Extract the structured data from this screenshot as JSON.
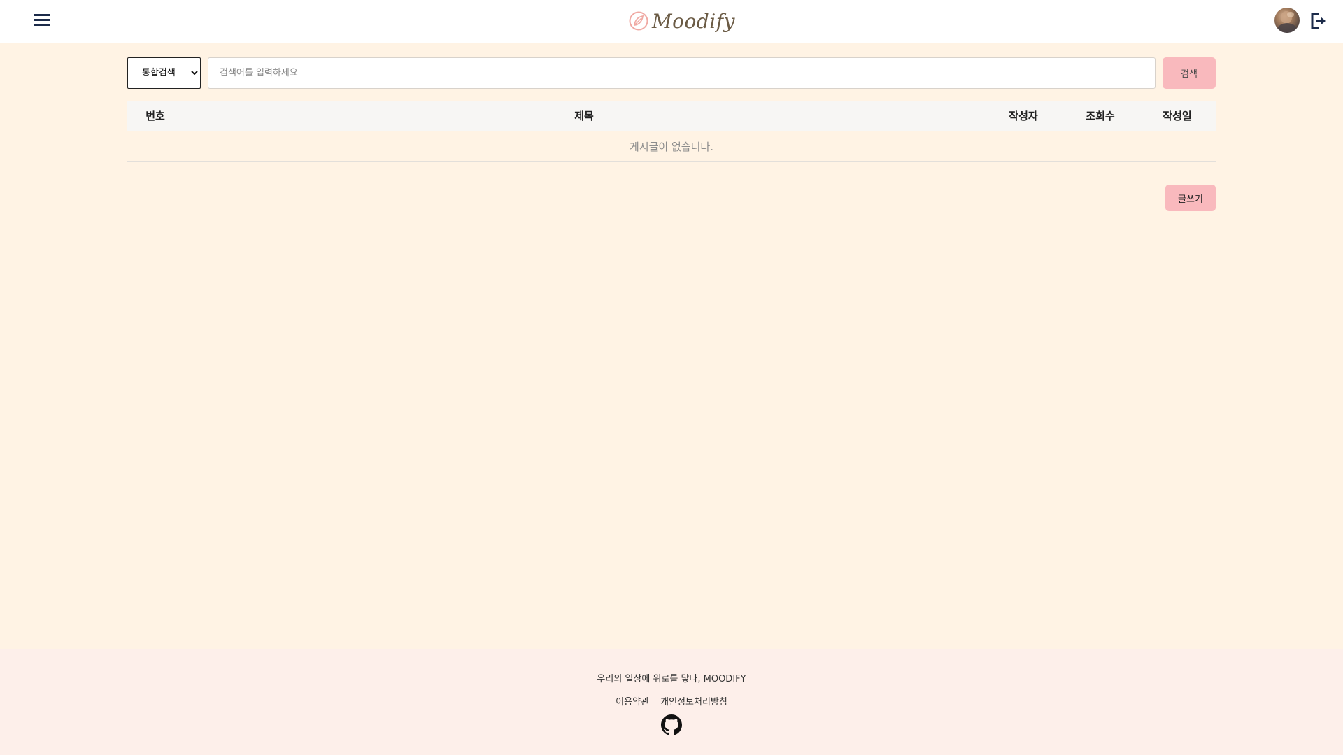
{
  "header": {
    "menu_icon": "hamburger-icon",
    "logo_text": "Moodify",
    "avatar_alt": "user avatar",
    "logout_icon": "logout-icon"
  },
  "search": {
    "type_options": [
      "통합검색"
    ],
    "type_selected": "통합검색",
    "placeholder": "검색어를 입력하세요",
    "value": "",
    "button_label": "검색"
  },
  "table": {
    "columns": [
      "번호",
      "제목",
      "작성자",
      "조회수",
      "작성일"
    ],
    "rows": [],
    "empty_message": "게시글이 없습니다."
  },
  "write_button_label": "글쓰기",
  "footer": {
    "slogan": "우리의 일상에 위로를 닿다, MOODIFY",
    "links": [
      "이용약관",
      "개인정보처리방침"
    ],
    "github_icon": "github-icon"
  },
  "colors": {
    "page_bg": "#fff3e4",
    "header_bg": "#ffffff",
    "accent_pink": "#f9b9bd",
    "footer_bg": "#fdefea",
    "icon_navy": "#1c2b4a"
  }
}
